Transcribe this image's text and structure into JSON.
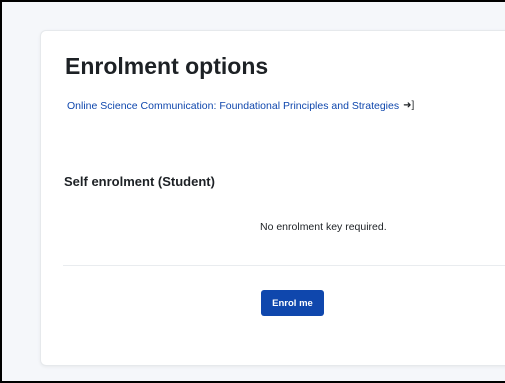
{
  "page": {
    "title": "Enrolment options"
  },
  "course": {
    "link_text": "Online Science Communication: Foundational Principles and Strategies",
    "link_icon": "sign-in-icon"
  },
  "enrolment": {
    "section_title": "Self enrolment (Student)",
    "key_note": "No enrolment key required.",
    "button_label": "Enrol me"
  },
  "colors": {
    "accent": "#0f47ad",
    "text": "#1d2125",
    "background": "#f5f7fa",
    "card": "#ffffff"
  }
}
